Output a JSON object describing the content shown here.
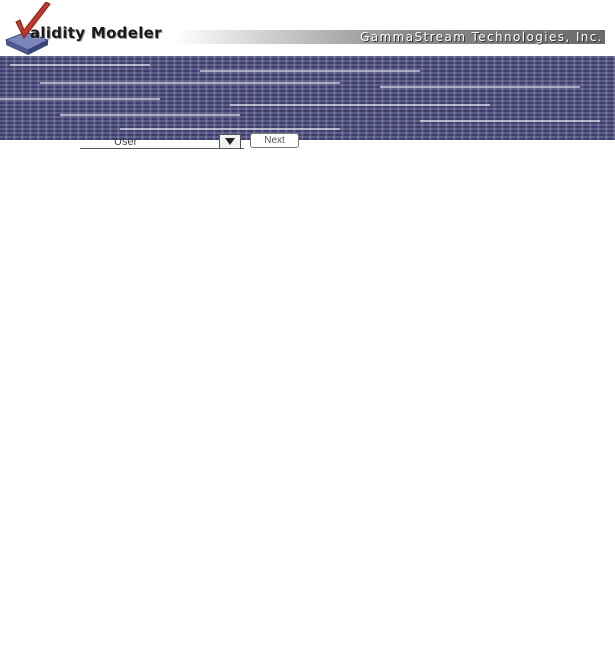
{
  "header": {
    "app_title": "alidity Modeler",
    "company_name": "GammaStream Technologies, Inc."
  },
  "form": {
    "field_value": "User",
    "next_label": "Next",
    "caption": "..."
  },
  "colors": {
    "banner": "#3c3d6e",
    "logo_check": "#c0392b",
    "logo_base": "#5b6aa8"
  },
  "icons": {
    "logo": "check-mark-logo-icon",
    "dropdown": "chevron-down-icon"
  }
}
